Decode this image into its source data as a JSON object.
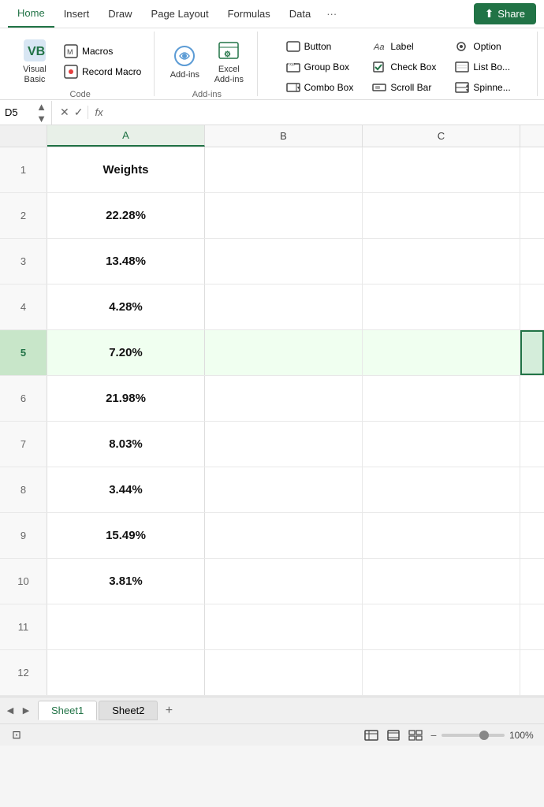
{
  "ribbon": {
    "tabs": [
      "Home",
      "Insert",
      "Draw",
      "Page Layout",
      "Formulas",
      "Data"
    ],
    "active_tab": "Home",
    "share_label": "Share",
    "groups": {
      "code": {
        "label": "Code",
        "visual_basic_label": "Visual\nBasic",
        "macros_label": "Macros",
        "record_macro_label": "Record Macro"
      },
      "add_ins": {
        "label": "Add-ins",
        "add_ins_label": "Add-ins",
        "excel_add_ins_label": "Excel\nAdd-ins"
      },
      "controls": {
        "label": "",
        "items": [
          {
            "label": "Button",
            "group": 1
          },
          {
            "label": "Group Box",
            "group": 1
          },
          {
            "label": "Combo Box",
            "group": 1
          },
          {
            "label": "Label",
            "group": 2
          },
          {
            "label": "Check Box",
            "group": 2
          },
          {
            "label": "Scroll Bar",
            "group": 2
          },
          {
            "label": "Option",
            "group": 3
          },
          {
            "label": "Spinner",
            "group": 3
          }
        ]
      }
    }
  },
  "formula_bar": {
    "cell_ref": "D5",
    "fx_label": "fx"
  },
  "columns": [
    "A",
    "B",
    "C"
  ],
  "rows": [
    {
      "num": 1,
      "a": "Weights",
      "b": "",
      "c": "",
      "is_header": true
    },
    {
      "num": 2,
      "a": "22.28%",
      "b": "",
      "c": "",
      "is_header": false
    },
    {
      "num": 3,
      "a": "13.48%",
      "b": "",
      "c": "",
      "is_header": false
    },
    {
      "num": 4,
      "a": "4.28%",
      "b": "",
      "c": "",
      "is_header": false
    },
    {
      "num": 5,
      "a": "7.20%",
      "b": "",
      "c": "",
      "is_header": false,
      "active": true
    },
    {
      "num": 6,
      "a": "21.98%",
      "b": "",
      "c": "",
      "is_header": false
    },
    {
      "num": 7,
      "a": "8.03%",
      "b": "",
      "c": "",
      "is_header": false
    },
    {
      "num": 8,
      "a": "3.44%",
      "b": "",
      "c": "",
      "is_header": false
    },
    {
      "num": 9,
      "a": "15.49%",
      "b": "",
      "c": "",
      "is_header": false
    },
    {
      "num": 10,
      "a": "3.81%",
      "b": "",
      "c": "",
      "is_header": false
    },
    {
      "num": 11,
      "a": "",
      "b": "",
      "c": "",
      "is_header": false
    },
    {
      "num": 12,
      "a": "",
      "b": "",
      "c": "",
      "is_header": false
    }
  ],
  "sheets": [
    "Sheet1",
    "Sheet2"
  ],
  "active_sheet": "Sheet1",
  "status": {
    "zoom": "100%"
  }
}
